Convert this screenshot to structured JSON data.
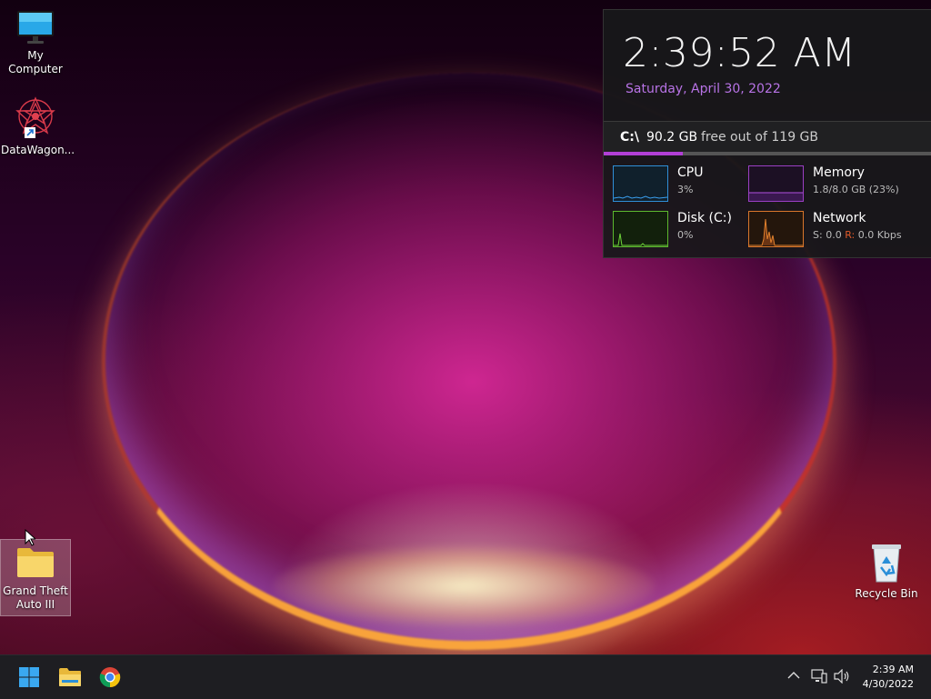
{
  "desktop": {
    "icons": [
      {
        "label": "My Computer",
        "icon": "monitor-icon"
      },
      {
        "label": "DataWagon...",
        "icon": "datawagon-app-icon"
      },
      {
        "label": "Grand Theft Auto III",
        "icon": "folder-icon"
      },
      {
        "label": "Recycle Bin",
        "icon": "recycle-bin-icon"
      }
    ]
  },
  "widget": {
    "time": "2:39:52 AM",
    "date": "Saturday, April 30, 2022",
    "disk": {
      "drive": "C:\\",
      "free": "90.2 GB",
      "total_text": "free out of 119 GB",
      "used_fraction": 0.242
    },
    "meters": [
      {
        "name": "CPU",
        "value": "3%",
        "color": "#2f8fd8"
      },
      {
        "name": "Memory",
        "value": "1.8/8.0 GB (23%)",
        "color": "#9b3fc4"
      },
      {
        "name": "Disk (C:)",
        "value": "0%",
        "color": "#5cb82e"
      },
      {
        "name": "Network",
        "send_label": "S:",
        "send_value": "0.0",
        "recv_label": "R:",
        "recv_value": "0.0 Kbps",
        "color": "#d9762b"
      }
    ]
  },
  "taskbar": {
    "apps": [
      {
        "name": "Start",
        "icon": "windows-start-icon"
      },
      {
        "name": "File Explorer",
        "icon": "file-explorer-icon"
      },
      {
        "name": "Google Chrome",
        "icon": "chrome-icon"
      }
    ],
    "tray": {
      "icons": [
        "chevron-up-icon",
        "network-icon",
        "volume-icon"
      ],
      "time": "2:39 AM",
      "date": "4/30/2022"
    }
  },
  "colors": {
    "accent": "#b23fd6",
    "taskbar_bg": "#1e1e22",
    "widget_bg": "#18181a"
  }
}
